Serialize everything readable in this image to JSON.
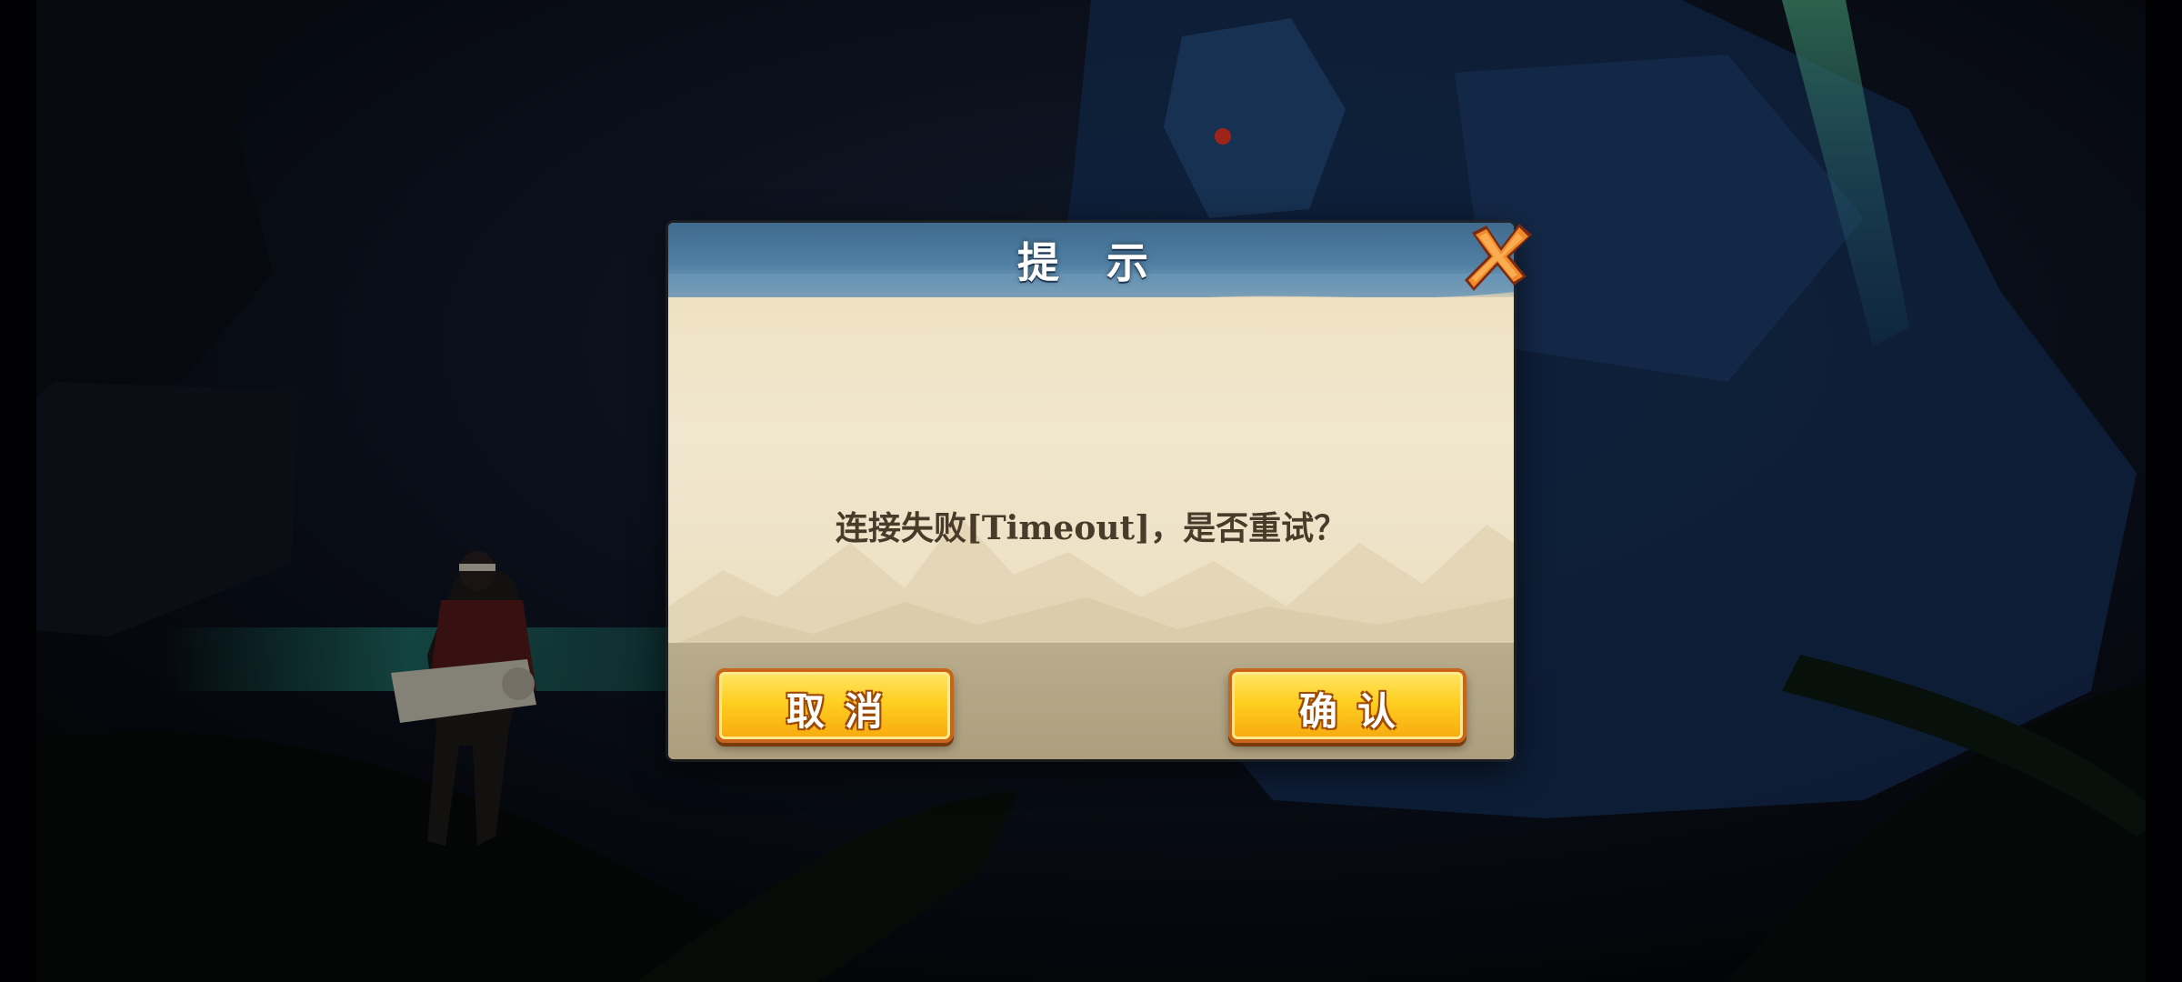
{
  "dialog": {
    "title": "提 示",
    "message": "连接失败[Timeout]，是否重试？",
    "cancel_label": "取消",
    "confirm_label": "确认",
    "close_icon": "close-x-icon"
  },
  "colors": {
    "header_blue": "#4f7fa3",
    "parchment": "#efe4c8",
    "button_gold": "#ffcf21",
    "button_border": "#c7651a",
    "message_text": "#4a3a2a",
    "close_orange": "#f08a2a"
  }
}
